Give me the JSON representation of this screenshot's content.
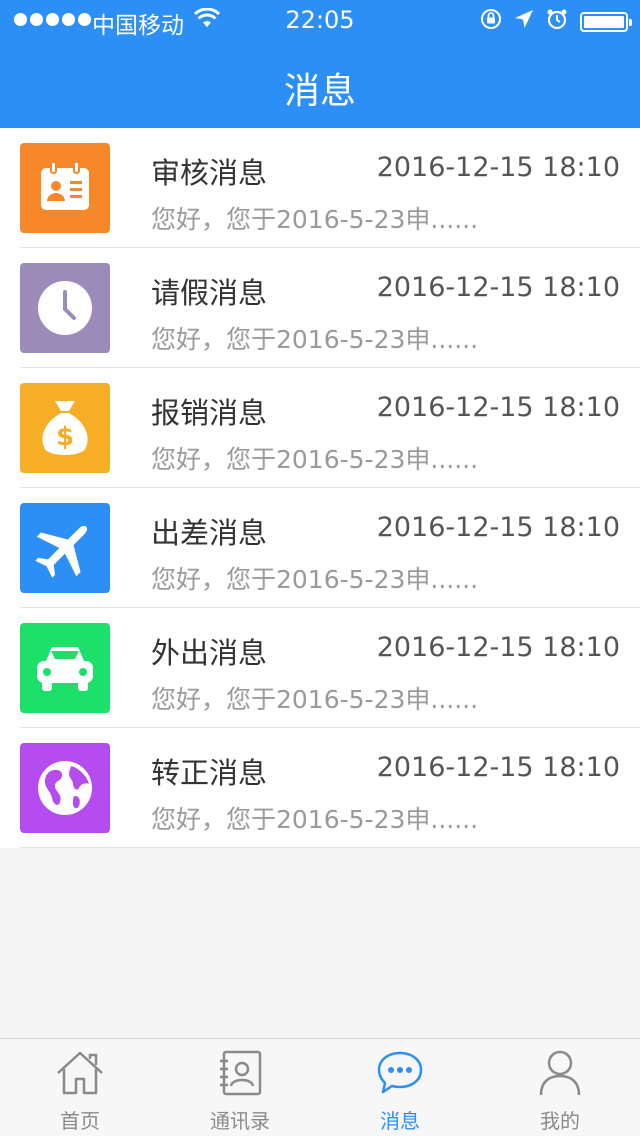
{
  "status_bar": {
    "carrier": "中国移动",
    "time": "22:05",
    "battery_level": 1.0,
    "signal_bars": 5
  },
  "nav": {
    "title": "消息"
  },
  "messages": [
    {
      "title": "审核消息",
      "time": "2016-12-15 18:10",
      "preview": "您好，您于2016-5-23申......",
      "icon": "id-card-icon",
      "color": "#f7882a"
    },
    {
      "title": "请假消息",
      "time": "2016-12-15 18:10",
      "preview": "您好，您于2016-5-23申......",
      "icon": "clock-icon",
      "color": "#9b8bb8"
    },
    {
      "title": "报销消息",
      "time": "2016-12-15 18:10",
      "preview": "您好，您于2016-5-23申......",
      "icon": "money-bag-icon",
      "color": "#f5ae25"
    },
    {
      "title": "出差消息",
      "time": "2016-12-15 18:10",
      "preview": "您好，您于2016-5-23申......",
      "icon": "airplane-icon",
      "color": "#2b8ff5"
    },
    {
      "title": "外出消息",
      "time": "2016-12-15 18:10",
      "preview": "您好，您于2016-5-23申......",
      "icon": "car-icon",
      "color": "#1de06a"
    },
    {
      "title": "转正消息",
      "time": "2016-12-15 18:10",
      "preview": "您好，您于2016-5-23申......",
      "icon": "globe-icon",
      "color": "#b54cf0"
    }
  ],
  "tabbar": {
    "tabs": [
      {
        "label": "首页",
        "icon": "home-icon",
        "active": false
      },
      {
        "label": "通讯录",
        "icon": "contacts-icon",
        "active": false
      },
      {
        "label": "消息",
        "icon": "chat-icon",
        "active": true
      },
      {
        "label": "我的",
        "icon": "person-icon",
        "active": false
      }
    ]
  },
  "colors": {
    "primary": "#2b8ff5",
    "tab_inactive": "#8a8a8a"
  }
}
